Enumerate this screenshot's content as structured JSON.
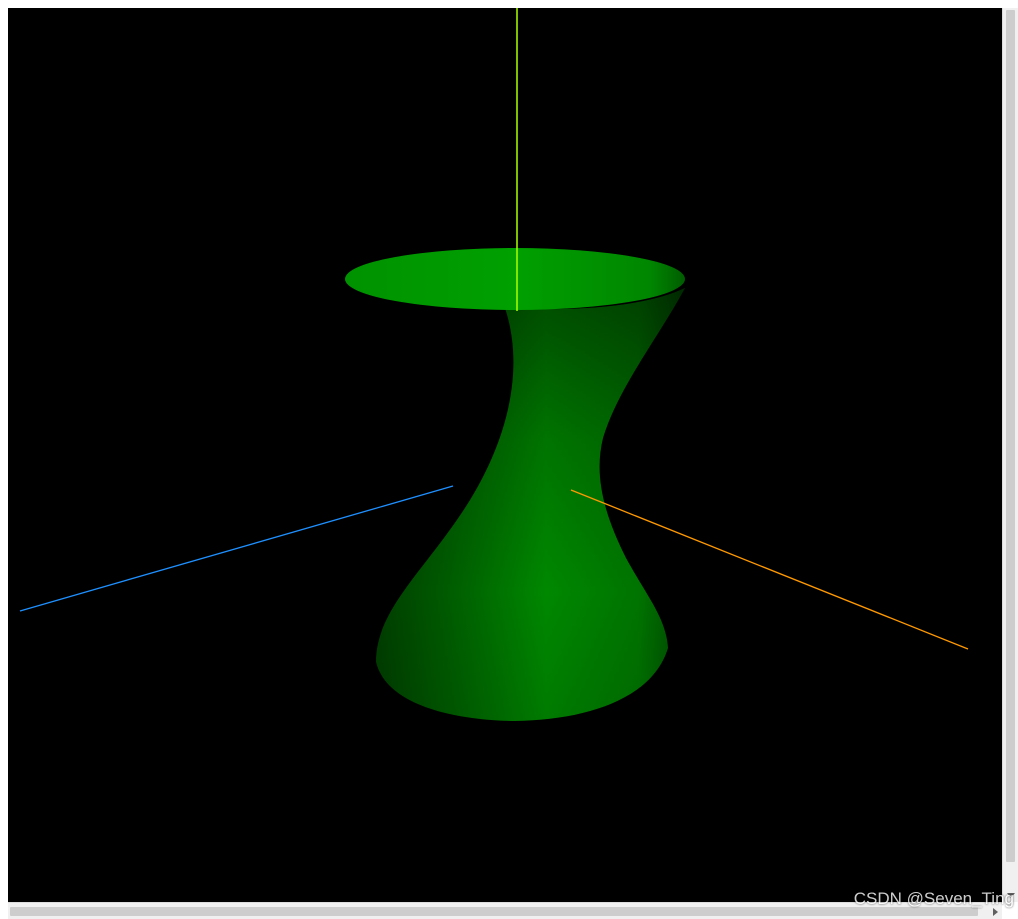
{
  "scene": {
    "background": "#000000",
    "surface_color": "#00a000",
    "axes": [
      {
        "name": "y-axis",
        "color": "#aaff00"
      },
      {
        "name": "z-axis",
        "color": "#1e90ff"
      },
      {
        "name": "x-axis",
        "color": "#ff9900"
      }
    ]
  },
  "watermark": {
    "text": "CSDN @Seven_Ting"
  }
}
